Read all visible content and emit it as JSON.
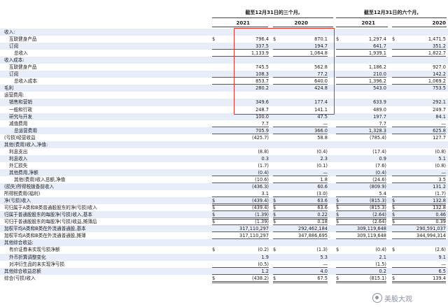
{
  "header": {
    "group1": "截至12月31日的三个月,",
    "group2": "截至12月31日的六个月,",
    "years": [
      "2021",
      "2020",
      "2021",
      "2020"
    ]
  },
  "rows": [
    {
      "label": "收入:",
      "indent": 0,
      "shade": true,
      "dollar": [
        false,
        false,
        false,
        false
      ],
      "values": [
        "",
        "",
        "",
        ""
      ]
    },
    {
      "label": "互联健身产品",
      "indent": 2,
      "shade": false,
      "dollar": [
        true,
        true,
        true,
        true
      ],
      "values": [
        "796.4",
        "870.1",
        "1,297.4",
        "1,471.5"
      ]
    },
    {
      "label": "订阅",
      "indent": 2,
      "shade": true,
      "dollar": [
        false,
        false,
        false,
        false
      ],
      "values": [
        "337.5",
        "194.7",
        "641.7",
        "351.2"
      ],
      "ul": true
    },
    {
      "label": "总收入",
      "indent": 4,
      "shade": false,
      "dollar": [
        false,
        false,
        false,
        false
      ],
      "values": [
        "1,133.9",
        "1,064.8",
        "1,939.1",
        "1,822.7"
      ],
      "ul": true
    },
    {
      "label": "收入成本:",
      "indent": 0,
      "shade": true,
      "dollar": [
        false,
        false,
        false,
        false
      ],
      "values": [
        "",
        "",
        "",
        ""
      ]
    },
    {
      "label": "互联健身产品",
      "indent": 2,
      "shade": false,
      "dollar": [
        false,
        false,
        false,
        false
      ],
      "values": [
        "745.5",
        "562.8",
        "1,186.2",
        "927.0"
      ]
    },
    {
      "label": "订阅",
      "indent": 2,
      "shade": true,
      "dollar": [
        false,
        false,
        false,
        false
      ],
      "values": [
        "108.3",
        "77.2",
        "210.0",
        "142.2"
      ],
      "ul": true
    },
    {
      "label": "总收入成本",
      "indent": 4,
      "shade": false,
      "dollar": [
        false,
        false,
        false,
        false
      ],
      "values": [
        "853.7",
        "640.0",
        "1,396.2",
        "1,069.2"
      ],
      "ul": true
    },
    {
      "label": "毛利",
      "indent": 0,
      "shade": true,
      "dollar": [
        false,
        false,
        false,
        false
      ],
      "values": [
        "280.2",
        "424.8",
        "543.0",
        "753.5"
      ]
    },
    {
      "label": "运营费用:",
      "indent": 0,
      "shade": false,
      "dollar": [
        false,
        false,
        false,
        false
      ],
      "values": [
        "",
        "",
        "",
        ""
      ]
    },
    {
      "label": "销售和营销",
      "indent": 2,
      "shade": true,
      "dollar": [
        false,
        false,
        false,
        false
      ],
      "values": [
        "349.6",
        "177.4",
        "633.9",
        "292.1"
      ]
    },
    {
      "label": "一般和行政",
      "indent": 2,
      "shade": false,
      "dollar": [
        false,
        false,
        false,
        false
      ],
      "values": [
        "248.7",
        "141.1",
        "489.0",
        "249.7"
      ]
    },
    {
      "label": "研究与开发",
      "indent": 2,
      "shade": true,
      "dollar": [
        false,
        false,
        false,
        false
      ],
      "values": [
        "100.0",
        "47.5",
        "197.7",
        "84.1"
      ]
    },
    {
      "label": "减值费用",
      "indent": 2,
      "shade": false,
      "dollar": [
        false,
        false,
        false,
        false
      ],
      "values": [
        "7.7",
        "—",
        "7.7",
        "—"
      ],
      "ul": true
    },
    {
      "label": "总运营费用",
      "indent": 4,
      "shade": true,
      "dollar": [
        false,
        false,
        false,
        false
      ],
      "values": [
        "705.9",
        "366.0",
        "1,328.3",
        "625.8"
      ],
      "ul": true
    },
    {
      "label": "(亏损)经营收益",
      "indent": 0,
      "shade": false,
      "dollar": [
        false,
        false,
        false,
        false
      ],
      "values": [
        "(425.7)",
        "58.8",
        "(785.4)",
        "127.7"
      ]
    },
    {
      "label": "其他(费用)收入,净值:",
      "indent": 0,
      "shade": true,
      "dollar": [
        false,
        false,
        false,
        false
      ],
      "values": [
        "",
        "",
        "",
        ""
      ]
    },
    {
      "label": "利息支出",
      "indent": 2,
      "shade": false,
      "dollar": [
        false,
        false,
        false,
        false
      ],
      "values": [
        "(8.8)",
        "(0.4)",
        "(17.4)",
        "(0.8)"
      ]
    },
    {
      "label": "利息收入",
      "indent": 2,
      "shade": true,
      "dollar": [
        false,
        false,
        false,
        false
      ],
      "values": [
        "0.3",
        "2.3",
        "0.9",
        "5.1"
      ]
    },
    {
      "label": "外汇损失",
      "indent": 2,
      "shade": false,
      "dollar": [
        false,
        false,
        false,
        false
      ],
      "values": [
        "(1.7)",
        "(0.1)",
        "(7.6)",
        "(0.8)"
      ]
    },
    {
      "label": "其他费用,净额",
      "indent": 2,
      "shade": true,
      "dollar": [
        false,
        false,
        false,
        false
      ],
      "values": [
        "(0.4)",
        "—",
        "(0.4)",
        "—"
      ],
      "ul": true
    },
    {
      "label": "其他(费用)收入总额,净值",
      "indent": 4,
      "shade": false,
      "dollar": [
        false,
        false,
        false,
        false
      ],
      "values": [
        "(10.6)",
        "1.8",
        "(24.6)",
        "3.5"
      ],
      "ul": true
    },
    {
      "label": "(损失)所得税拨备前收入",
      "indent": 0,
      "shade": true,
      "dollar": [
        false,
        false,
        false,
        false
      ],
      "values": [
        "(436.3)",
        "60.6",
        "(809.9)",
        "131.2"
      ]
    },
    {
      "label": "所得税费用(福利)",
      "indent": 0,
      "shade": false,
      "dollar": [
        false,
        false,
        false,
        false
      ],
      "values": [
        "3.1",
        "(3.0)",
        "5.4",
        "(1.7)"
      ],
      "ul": true
    },
    {
      "label": "净(亏损)收入",
      "indent": 0,
      "shade": true,
      "dollar": [
        true,
        true,
        true,
        true
      ],
      "values": [
        "(439.4)",
        "63.6",
        "(815.3)",
        "132.8"
      ],
      "ul": true,
      "ul2": true
    },
    {
      "label": "可归属于A类和B类普通股股东的净(亏损)收入",
      "indent": 0,
      "shade": false,
      "dollar": [
        true,
        true,
        true,
        true
      ],
      "values": [
        "(439.4)",
        "63.6",
        "(815.3)",
        "132.8"
      ],
      "ul": true,
      "ul2": true
    },
    {
      "label": "归属于普通股股东的每股净(亏损)收入,基本",
      "indent": 0,
      "shade": true,
      "dollar": [
        true,
        true,
        true,
        true
      ],
      "values": [
        "(1.39)",
        "0.22",
        "(2.64)",
        "0.46"
      ],
      "ul": true,
      "ul2": true
    },
    {
      "label": "可归于普通股股东的每股净(亏损)收益,摊薄后",
      "indent": 0,
      "shade": false,
      "dollar": [
        true,
        true,
        true,
        true
      ],
      "values": [
        "(1.39)",
        "0.18",
        "(2.64)",
        "0.39"
      ],
      "ul": true,
      "ul2": true
    },
    {
      "label": "加权平均A类和B类在外流通普通股,基本",
      "indent": 0,
      "shade": true,
      "dollar": [
        false,
        false,
        false,
        false
      ],
      "values": [
        "317,110,297",
        "292,462,184",
        "309,119,648",
        "290,591,037"
      ],
      "ul": true
    },
    {
      "label": "加权平均A类和B类在外流通普通股,摊薄",
      "indent": 0,
      "shade": false,
      "dollar": [
        false,
        false,
        false,
        false
      ],
      "values": [
        "317,110,297",
        "347,886,695",
        "309,119,648",
        "344,994,314"
      ],
      "ul": true
    },
    {
      "label": "其他综合收益:",
      "indent": 0,
      "shade": true,
      "dollar": [
        false,
        false,
        false,
        false
      ],
      "values": [
        "",
        "",
        "",
        ""
      ]
    },
    {
      "label": "有价证券未实现亏损净额",
      "indent": 2,
      "shade": false,
      "dollar": [
        true,
        true,
        true,
        true
      ],
      "values": [
        "(0.2)",
        "(1.3)",
        "(0.4)",
        "(2.6)"
      ]
    },
    {
      "label": "外币折算调整变化",
      "indent": 2,
      "shade": true,
      "dollar": [
        false,
        false,
        false,
        false
      ],
      "values": [
        "1.9",
        "5.3",
        "2.1",
        "9.1"
      ]
    },
    {
      "label": "对冲衍生品的未实现净亏损",
      "indent": 2,
      "shade": false,
      "dollar": [
        false,
        false,
        false,
        false
      ],
      "values": [
        "(0.5)",
        "—",
        "(1.5)",
        "—"
      ],
      "ul": true
    },
    {
      "label": "其他综合收益总额",
      "indent": 0,
      "shade": true,
      "dollar": [
        false,
        false,
        false,
        false
      ],
      "values": [
        "1.2",
        "4.0",
        "0.2",
        "6.5"
      ],
      "ul": true
    },
    {
      "label": "综合(亏损)收入",
      "indent": 0,
      "shade": false,
      "dollar": [
        true,
        true,
        true,
        true
      ],
      "values": [
        "(438.2)",
        "67.5",
        "(815.1)",
        "139.4"
      ],
      "ul": true,
      "ul2": true
    }
  ],
  "watermark": "美股大观",
  "colors": {
    "shade": "#e8eef9",
    "highlight": "#e0322a"
  }
}
